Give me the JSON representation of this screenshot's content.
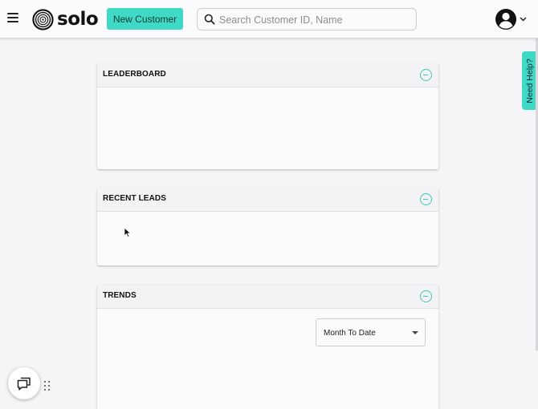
{
  "header": {
    "brand": "solo",
    "new_customer_label": "New Customer",
    "search_placeholder": "Search Customer ID, Name, or",
    "icons": {
      "menu": "hamburger-icon",
      "logo": "solo-swirl-logo",
      "search": "search-icon",
      "account": "account-circle-icon",
      "dropdown": "chevron-down-icon"
    }
  },
  "cards": {
    "leaderboard": {
      "title": "LEADERBOARD"
    },
    "recent_leads": {
      "title": "RECENT LEADS"
    },
    "trends": {
      "title": "TRENDS",
      "period_selected": "Month To Date"
    }
  },
  "help_tab": {
    "label": "Need Help?"
  },
  "widgets": {
    "chat_icon": "chat-bubbles-icon",
    "drag_icon": "drag-handle-icon"
  },
  "colors": {
    "accent": "#3fd9c5",
    "background": "#f5f4f6",
    "card": "#fbfafc"
  }
}
